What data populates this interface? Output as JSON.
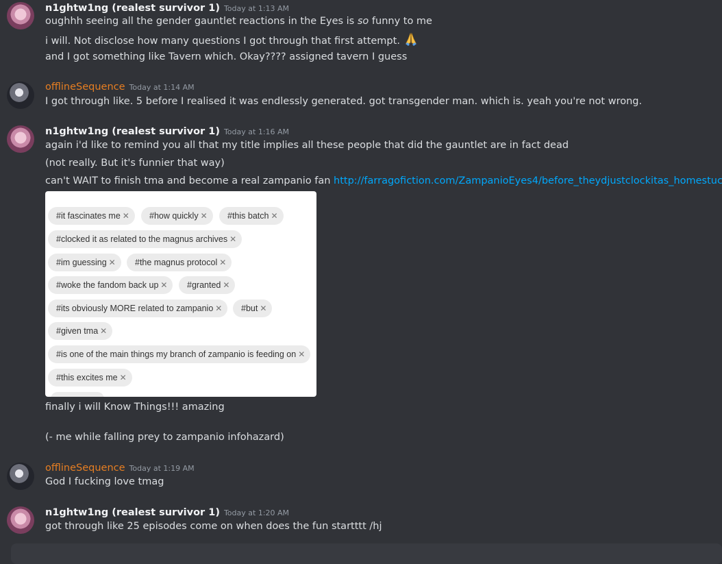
{
  "messages": [
    {
      "author": "n1ghtw1ng (realest survivor 1)",
      "time": "Today at 1:13 AM",
      "lines": [
        {
          "pre": "oughhh seeing all the gender gauntlet reactions in the Eyes is ",
          "em": "so",
          "post": " funny to me"
        },
        {
          "text": "i will. Not disclose how many questions I got through that first attempt. "
        },
        {
          "text": "and I got something like Tavern which. Okay???? assigned tavern I guess"
        }
      ]
    },
    {
      "author": "offlineSequence",
      "time": "Today at 1:14 AM",
      "lines": [
        {
          "text": "I got through like. 5 before I realised it was endlessly generated. got transgender man. which is. yeah you're not wrong."
        }
      ]
    },
    {
      "author": "n1ghtw1ng (realest survivor 1)",
      "time": "Today at 1:16 AM",
      "lines": [
        {
          "text": "again i'd like to remind you all that my title implies all these people that did the gauntlet are in fact dead"
        },
        {
          "text": "(not really. But it's funnier that way)"
        },
        {
          "text": "can't WAIT to finish tma and become a real zampanio fan ",
          "link": "http://farragofiction.com/ZampanioEyes4/before_theydjustclockitas_homestuck.png"
        }
      ],
      "tags": [
        "#it fascinates me",
        "#how quickly",
        "#this batch",
        "#clocked it as related to the magnus archives",
        "#im guessing",
        "#the magnus protocol",
        "#woke the fandom back up",
        "#granted",
        "#its obviously MORE related to zampanio",
        "#but",
        "#given tma",
        "#is one of the main things my branch of zampanio is feeding on",
        "#this excites me"
      ],
      "after_lines": [
        {
          "text": "finally i will Know Things!!! amazing"
        },
        {
          "text": "(- me while falling prey to zampanio infohazard)"
        }
      ]
    },
    {
      "author": "offlineSequence",
      "time": "Today at 1:19 AM",
      "lines": [
        {
          "text": "God I fucking love tmag"
        }
      ]
    },
    {
      "author": "n1ghtw1ng (realest survivor 1)",
      "time": "Today at 1:20 AM",
      "lines": [
        {
          "text": "got through like 25 episodes come on when does the fun startttt /hj"
        }
      ]
    }
  ],
  "colors": {
    "background": "#313338",
    "text": "#dbdee1",
    "offline_name": "#e67e22",
    "link": "#00a8fc",
    "timestamp": "#949ba4"
  },
  "icons": {
    "tag_remove": "close-icon",
    "prayer_emoji": "folded-hands-emoji"
  }
}
